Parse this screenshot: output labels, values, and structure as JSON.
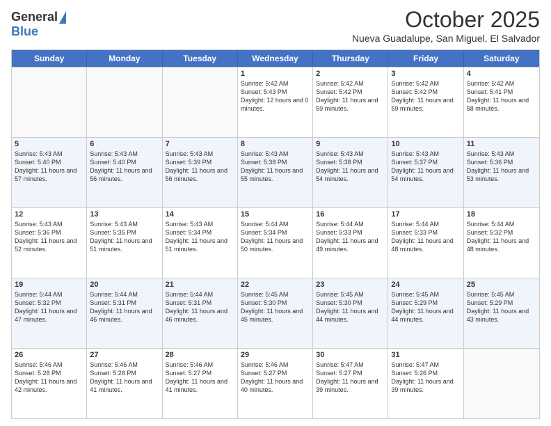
{
  "logo": {
    "general": "General",
    "blue": "Blue"
  },
  "title": "October 2025",
  "location": "Nueva Guadalupe, San Miguel, El Salvador",
  "days_of_week": [
    "Sunday",
    "Monday",
    "Tuesday",
    "Wednesday",
    "Thursday",
    "Friday",
    "Saturday"
  ],
  "weeks": [
    [
      {
        "day": "",
        "sunrise": "",
        "sunset": "",
        "daylight": ""
      },
      {
        "day": "",
        "sunrise": "",
        "sunset": "",
        "daylight": ""
      },
      {
        "day": "",
        "sunrise": "",
        "sunset": "",
        "daylight": ""
      },
      {
        "day": "1",
        "sunrise": "Sunrise: 5:42 AM",
        "sunset": "Sunset: 5:43 PM",
        "daylight": "Daylight: 12 hours and 0 minutes."
      },
      {
        "day": "2",
        "sunrise": "Sunrise: 5:42 AM",
        "sunset": "Sunset: 5:42 PM",
        "daylight": "Daylight: 11 hours and 59 minutes."
      },
      {
        "day": "3",
        "sunrise": "Sunrise: 5:42 AM",
        "sunset": "Sunset: 5:42 PM",
        "daylight": "Daylight: 11 hours and 59 minutes."
      },
      {
        "day": "4",
        "sunrise": "Sunrise: 5:42 AM",
        "sunset": "Sunset: 5:41 PM",
        "daylight": "Daylight: 11 hours and 58 minutes."
      }
    ],
    [
      {
        "day": "5",
        "sunrise": "Sunrise: 5:43 AM",
        "sunset": "Sunset: 5:40 PM",
        "daylight": "Daylight: 11 hours and 57 minutes."
      },
      {
        "day": "6",
        "sunrise": "Sunrise: 5:43 AM",
        "sunset": "Sunset: 5:40 PM",
        "daylight": "Daylight: 11 hours and 56 minutes."
      },
      {
        "day": "7",
        "sunrise": "Sunrise: 5:43 AM",
        "sunset": "Sunset: 5:39 PM",
        "daylight": "Daylight: 11 hours and 56 minutes."
      },
      {
        "day": "8",
        "sunrise": "Sunrise: 5:43 AM",
        "sunset": "Sunset: 5:38 PM",
        "daylight": "Daylight: 11 hours and 55 minutes."
      },
      {
        "day": "9",
        "sunrise": "Sunrise: 5:43 AM",
        "sunset": "Sunset: 5:38 PM",
        "daylight": "Daylight: 11 hours and 54 minutes."
      },
      {
        "day": "10",
        "sunrise": "Sunrise: 5:43 AM",
        "sunset": "Sunset: 5:37 PM",
        "daylight": "Daylight: 11 hours and 54 minutes."
      },
      {
        "day": "11",
        "sunrise": "Sunrise: 5:43 AM",
        "sunset": "Sunset: 5:36 PM",
        "daylight": "Daylight: 11 hours and 53 minutes."
      }
    ],
    [
      {
        "day": "12",
        "sunrise": "Sunrise: 5:43 AM",
        "sunset": "Sunset: 5:36 PM",
        "daylight": "Daylight: 11 hours and 52 minutes."
      },
      {
        "day": "13",
        "sunrise": "Sunrise: 5:43 AM",
        "sunset": "Sunset: 5:35 PM",
        "daylight": "Daylight: 11 hours and 51 minutes."
      },
      {
        "day": "14",
        "sunrise": "Sunrise: 5:43 AM",
        "sunset": "Sunset: 5:34 PM",
        "daylight": "Daylight: 11 hours and 51 minutes."
      },
      {
        "day": "15",
        "sunrise": "Sunrise: 5:44 AM",
        "sunset": "Sunset: 5:34 PM",
        "daylight": "Daylight: 11 hours and 50 minutes."
      },
      {
        "day": "16",
        "sunrise": "Sunrise: 5:44 AM",
        "sunset": "Sunset: 5:33 PM",
        "daylight": "Daylight: 11 hours and 49 minutes."
      },
      {
        "day": "17",
        "sunrise": "Sunrise: 5:44 AM",
        "sunset": "Sunset: 5:33 PM",
        "daylight": "Daylight: 11 hours and 48 minutes."
      },
      {
        "day": "18",
        "sunrise": "Sunrise: 5:44 AM",
        "sunset": "Sunset: 5:32 PM",
        "daylight": "Daylight: 11 hours and 48 minutes."
      }
    ],
    [
      {
        "day": "19",
        "sunrise": "Sunrise: 5:44 AM",
        "sunset": "Sunset: 5:32 PM",
        "daylight": "Daylight: 11 hours and 47 minutes."
      },
      {
        "day": "20",
        "sunrise": "Sunrise: 5:44 AM",
        "sunset": "Sunset: 5:31 PM",
        "daylight": "Daylight: 11 hours and 46 minutes."
      },
      {
        "day": "21",
        "sunrise": "Sunrise: 5:44 AM",
        "sunset": "Sunset: 5:31 PM",
        "daylight": "Daylight: 11 hours and 46 minutes."
      },
      {
        "day": "22",
        "sunrise": "Sunrise: 5:45 AM",
        "sunset": "Sunset: 5:30 PM",
        "daylight": "Daylight: 11 hours and 45 minutes."
      },
      {
        "day": "23",
        "sunrise": "Sunrise: 5:45 AM",
        "sunset": "Sunset: 5:30 PM",
        "daylight": "Daylight: 11 hours and 44 minutes."
      },
      {
        "day": "24",
        "sunrise": "Sunrise: 5:45 AM",
        "sunset": "Sunset: 5:29 PM",
        "daylight": "Daylight: 11 hours and 44 minutes."
      },
      {
        "day": "25",
        "sunrise": "Sunrise: 5:45 AM",
        "sunset": "Sunset: 5:29 PM",
        "daylight": "Daylight: 11 hours and 43 minutes."
      }
    ],
    [
      {
        "day": "26",
        "sunrise": "Sunrise: 5:46 AM",
        "sunset": "Sunset: 5:28 PM",
        "daylight": "Daylight: 11 hours and 42 minutes."
      },
      {
        "day": "27",
        "sunrise": "Sunrise: 5:46 AM",
        "sunset": "Sunset: 5:28 PM",
        "daylight": "Daylight: 11 hours and 41 minutes."
      },
      {
        "day": "28",
        "sunrise": "Sunrise: 5:46 AM",
        "sunset": "Sunset: 5:27 PM",
        "daylight": "Daylight: 11 hours and 41 minutes."
      },
      {
        "day": "29",
        "sunrise": "Sunrise: 5:46 AM",
        "sunset": "Sunset: 5:27 PM",
        "daylight": "Daylight: 11 hours and 40 minutes."
      },
      {
        "day": "30",
        "sunrise": "Sunrise: 5:47 AM",
        "sunset": "Sunset: 5:27 PM",
        "daylight": "Daylight: 11 hours and 39 minutes."
      },
      {
        "day": "31",
        "sunrise": "Sunrise: 5:47 AM",
        "sunset": "Sunset: 5:26 PM",
        "daylight": "Daylight: 11 hours and 39 minutes."
      },
      {
        "day": "",
        "sunrise": "",
        "sunset": "",
        "daylight": ""
      }
    ]
  ]
}
